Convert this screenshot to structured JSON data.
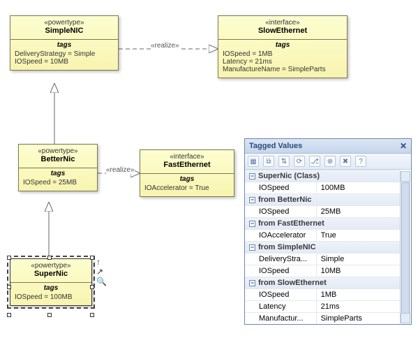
{
  "classes": {
    "simpleNic": {
      "stereo": "«powertype»",
      "name": "SimpleNIC",
      "tagsHeader": "tags",
      "tags": [
        "DeliveryStrategy = Simple",
        "IOSpeed = 10MB"
      ]
    },
    "slowEth": {
      "stereo": "«interface»",
      "name": "SlowEthernet",
      "tagsHeader": "tags",
      "tags": [
        "IOSpeed = 1MB",
        "Latency = 21ms",
        "ManufactureName = SimpleParts"
      ]
    },
    "betterNic": {
      "stereo": "«powertype»",
      "name": "BetterNic",
      "tagsHeader": "tags",
      "tags": [
        "IOSpeed = 25MB"
      ]
    },
    "fastEth": {
      "stereo": "«interface»",
      "name": "FastEthernet",
      "tagsHeader": "tags",
      "tags": [
        "IOAccelerator = True"
      ]
    },
    "superNic": {
      "stereo": "«powertype»",
      "name": "SuperNic",
      "tagsHeader": "tags",
      "tags": [
        "IOSpeed = 100MB"
      ]
    }
  },
  "edges": {
    "realize1": "«realize»",
    "realize2": "«realize»"
  },
  "panel": {
    "title": "Tagged Values",
    "toolbar_icons": [
      "grid-icon",
      "id-icon",
      "sort-icon",
      "refresh-icon",
      "branch-icon",
      "tag-icon",
      "delete-icon",
      "help-icon"
    ],
    "groups": [
      {
        "label": "SuperNic (Class)",
        "rows": [
          {
            "k": "IOSpeed",
            "v": "100MB"
          }
        ]
      },
      {
        "label": "from BetterNic",
        "rows": [
          {
            "k": "IOSpeed",
            "v": "25MB"
          }
        ]
      },
      {
        "label": "from FastEthernet",
        "rows": [
          {
            "k": "IOAccelerator",
            "v": "True"
          }
        ]
      },
      {
        "label": "from SimpleNIC",
        "rows": [
          {
            "k": "DeliveryStra...",
            "v": "Simple"
          },
          {
            "k": "IOSpeed",
            "v": "10MB"
          }
        ]
      },
      {
        "label": "from SlowEthernet",
        "rows": [
          {
            "k": "IOSpeed",
            "v": "1MB"
          },
          {
            "k": "Latency",
            "v": "21ms"
          },
          {
            "k": "Manufactur...",
            "v": "SimpleParts"
          }
        ]
      }
    ]
  },
  "chart_data": {
    "type": "table",
    "title": "UML class diagram – NIC powertype hierarchy with tagged values",
    "nodes": [
      {
        "id": "SimpleNIC",
        "stereotype": "powertype",
        "tags": {
          "DeliveryStrategy": "Simple",
          "IOSpeed": "10MB"
        }
      },
      {
        "id": "SlowEthernet",
        "stereotype": "interface",
        "tags": {
          "IOSpeed": "1MB",
          "Latency": "21ms",
          "ManufactureName": "SimpleParts"
        }
      },
      {
        "id": "BetterNic",
        "stereotype": "powertype",
        "tags": {
          "IOSpeed": "25MB"
        }
      },
      {
        "id": "FastEthernet",
        "stereotype": "interface",
        "tags": {
          "IOAccelerator": "True"
        }
      },
      {
        "id": "SuperNic",
        "stereotype": "powertype",
        "tags": {
          "IOSpeed": "100MB"
        }
      }
    ],
    "edges": [
      {
        "from": "SimpleNIC",
        "to": "SlowEthernet",
        "type": "realize"
      },
      {
        "from": "BetterNic",
        "to": "SimpleNIC",
        "type": "generalization"
      },
      {
        "from": "BetterNic",
        "to": "FastEthernet",
        "type": "realize"
      },
      {
        "from": "SuperNic",
        "to": "BetterNic",
        "type": "generalization"
      }
    ],
    "tagged_values_panel": {
      "selected": "SuperNic (Class)",
      "resolved": [
        {
          "scope": "SuperNic (Class)",
          "IOSpeed": "100MB"
        },
        {
          "scope": "from BetterNic",
          "IOSpeed": "25MB"
        },
        {
          "scope": "from FastEthernet",
          "IOAccelerator": "True"
        },
        {
          "scope": "from SimpleNIC",
          "DeliveryStrategy": "Simple",
          "IOSpeed": "10MB"
        },
        {
          "scope": "from SlowEthernet",
          "IOSpeed": "1MB",
          "Latency": "21ms",
          "ManufactureName": "SimpleParts"
        }
      ]
    }
  }
}
